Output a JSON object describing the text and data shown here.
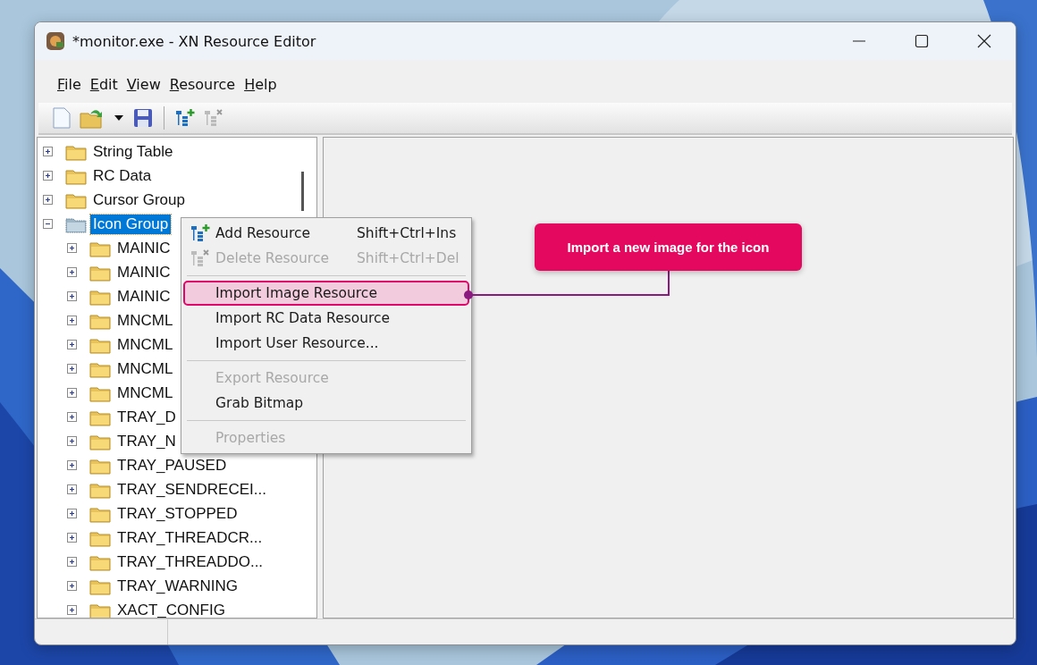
{
  "window": {
    "title": "*monitor.exe - XN Resource Editor"
  },
  "menu_bar": [
    {
      "label": "File"
    },
    {
      "label": "Edit"
    },
    {
      "label": "View"
    },
    {
      "label": "Resource"
    },
    {
      "label": "Help"
    }
  ],
  "toolbar": [
    {
      "kind": "new",
      "disabled": false
    },
    {
      "kind": "open",
      "disabled": false
    },
    {
      "kind": "dropdown",
      "disabled": false
    },
    {
      "kind": "save",
      "disabled": false
    },
    {
      "kind": "separator"
    },
    {
      "kind": "add",
      "disabled": false
    },
    {
      "kind": "delete",
      "disabled": true
    }
  ],
  "tree": [
    {
      "label": "String Table",
      "expanded": false,
      "selected": false
    },
    {
      "label": "RC Data",
      "expanded": false,
      "selected": false
    },
    {
      "label": "Cursor Group",
      "expanded": false,
      "selected": false
    },
    {
      "label": "Icon Group",
      "expanded": true,
      "selected": true,
      "children": [
        {
          "label": "MAINIC",
          "expanded": false,
          "selected": false
        },
        {
          "label": "MAINIC",
          "expanded": false,
          "selected": false
        },
        {
          "label": "MAINIC",
          "expanded": false,
          "selected": false
        },
        {
          "label": "MNCML",
          "expanded": false,
          "selected": false
        },
        {
          "label": "MNCML",
          "expanded": false,
          "selected": false
        },
        {
          "label": "MNCML",
          "expanded": false,
          "selected": false
        },
        {
          "label": "MNCML",
          "expanded": false,
          "selected": false
        },
        {
          "label": "TRAY_D",
          "expanded": false,
          "selected": false
        },
        {
          "label": "TRAY_N",
          "expanded": false,
          "selected": false
        },
        {
          "label": "TRAY_PAUSED",
          "expanded": false,
          "selected": false
        },
        {
          "label": "TRAY_SENDRECEI...",
          "expanded": false,
          "selected": false
        },
        {
          "label": "TRAY_STOPPED",
          "expanded": false,
          "selected": false
        },
        {
          "label": "TRAY_THREADCR...",
          "expanded": false,
          "selected": false
        },
        {
          "label": "TRAY_THREADDO...",
          "expanded": false,
          "selected": false
        },
        {
          "label": "TRAY_WARNING",
          "expanded": false,
          "selected": false
        },
        {
          "label": "XACT_CONFIG",
          "expanded": false,
          "selected": false
        }
      ]
    }
  ],
  "context_menu": {
    "items": [
      {
        "kind": "add",
        "label": "Add Resource",
        "shortcut": "Shift+Ctrl+Ins",
        "disabled": false,
        "selected": false
      },
      {
        "kind": "delete",
        "label": "Delete Resource",
        "shortcut": "Shift+Ctrl+Del",
        "disabled": true,
        "selected": false
      },
      {
        "kind": "separator"
      },
      {
        "kind": "item",
        "label": "Import Image Resource",
        "disabled": false,
        "selected": true
      },
      {
        "kind": "item",
        "label": "Import RC Data Resource",
        "disabled": false,
        "selected": false
      },
      {
        "kind": "item",
        "label": "Import User Resource...",
        "disabled": false,
        "selected": false
      },
      {
        "kind": "separator"
      },
      {
        "kind": "item",
        "label": "Export Resource",
        "disabled": true,
        "selected": false
      },
      {
        "kind": "item",
        "label": "Grab Bitmap",
        "disabled": false,
        "selected": false
      },
      {
        "kind": "separator"
      },
      {
        "kind": "item",
        "label": "Properties",
        "disabled": true,
        "selected": false
      }
    ]
  },
  "callout": {
    "text": "Import a new image for the icon"
  }
}
